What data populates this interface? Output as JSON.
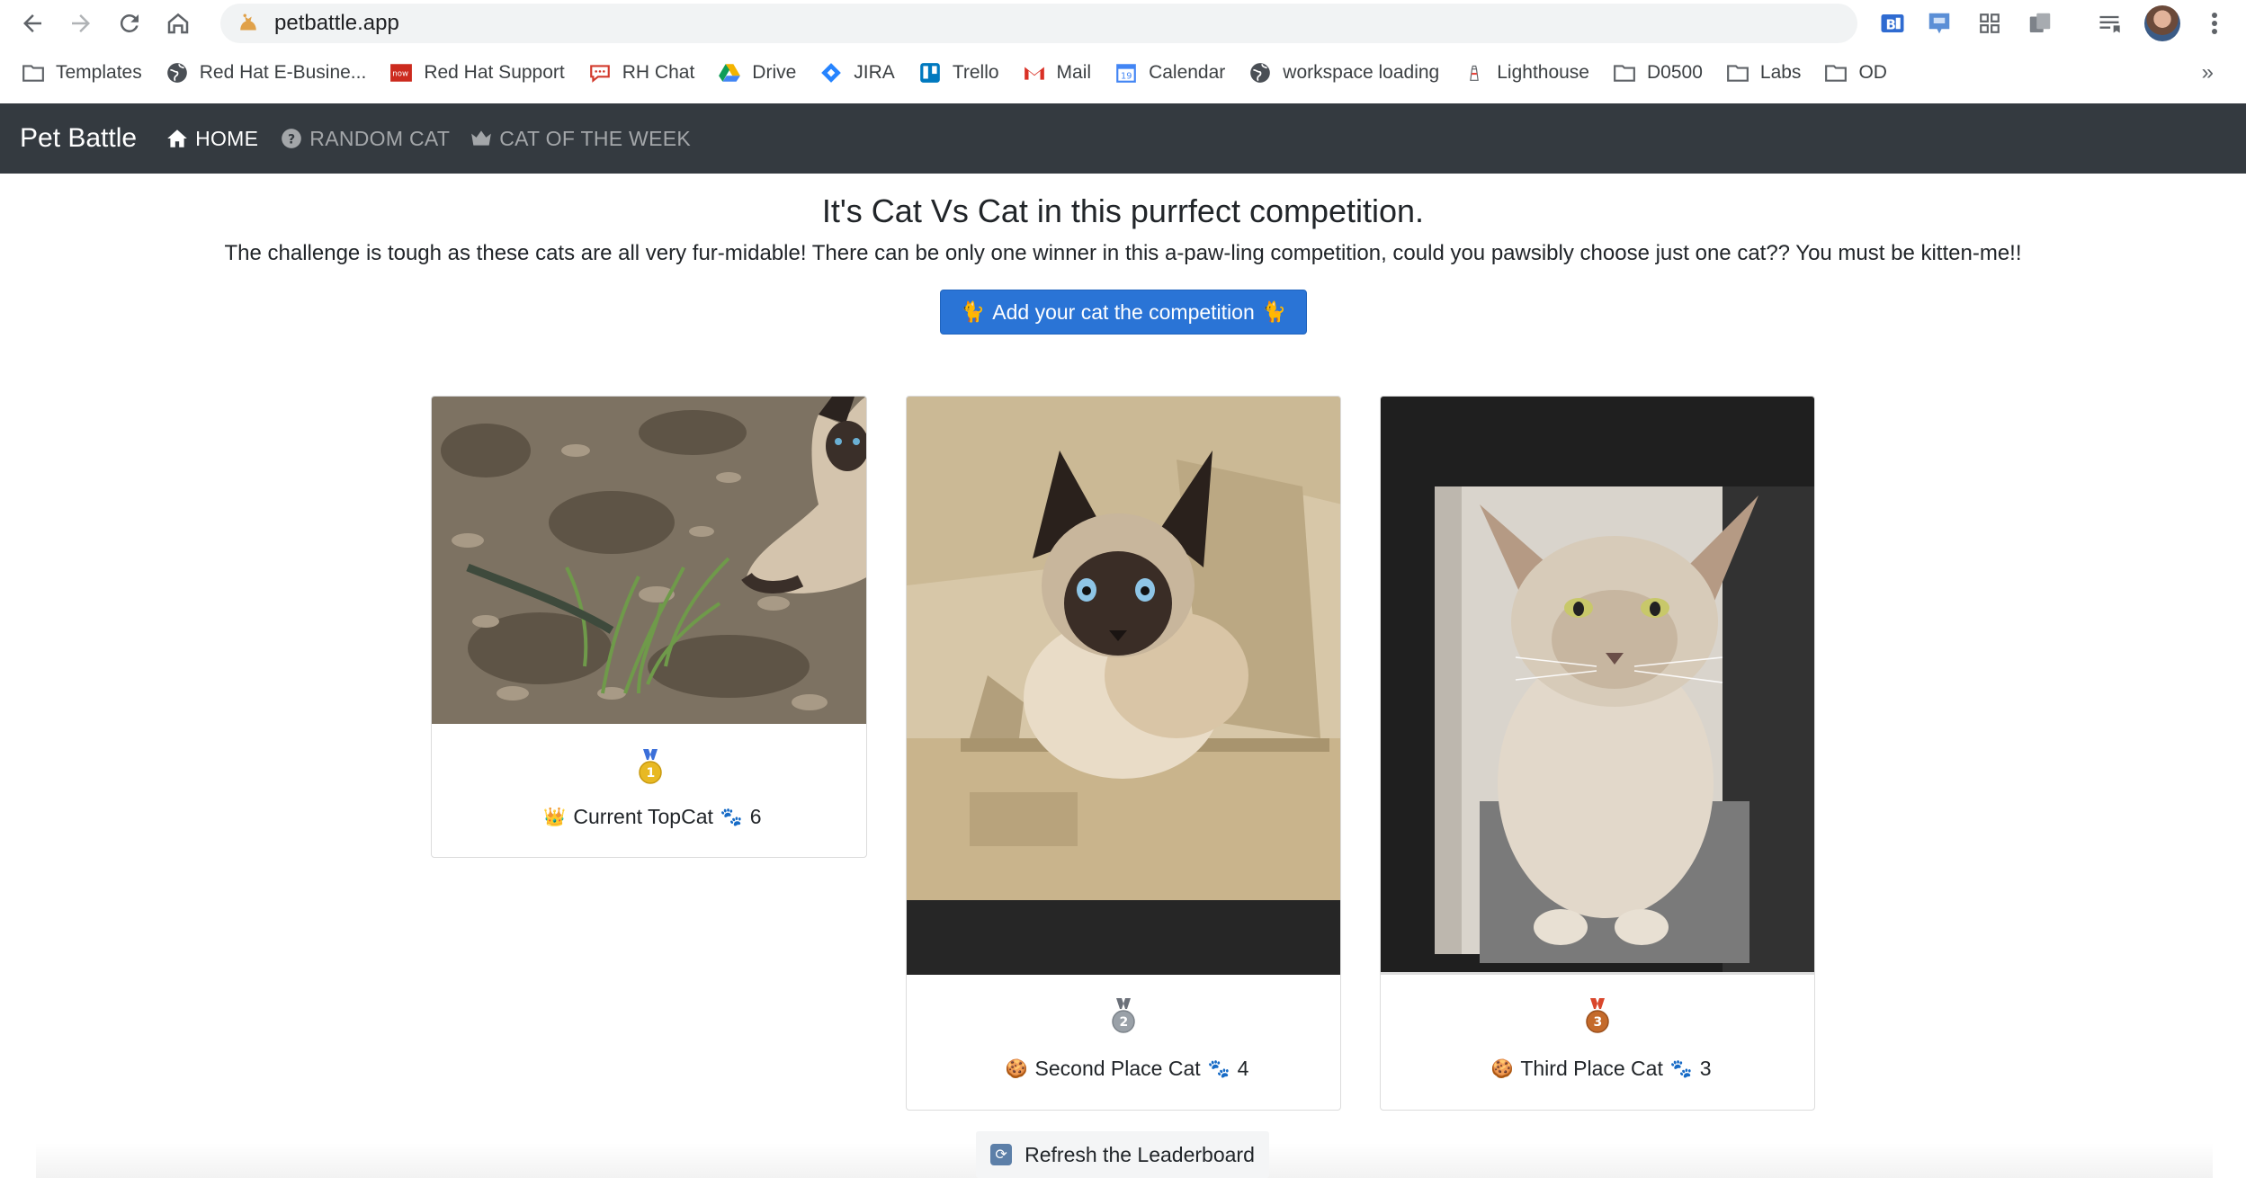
{
  "browser": {
    "url": "petbattle.app",
    "bookmarks": [
      {
        "label": "Templates",
        "icon": "folder-icon"
      },
      {
        "label": "Red Hat E-Busine...",
        "icon": "globe-icon"
      },
      {
        "label": "Red Hat Support",
        "icon": "redhat-now-icon"
      },
      {
        "label": "RH Chat",
        "icon": "chat-icon"
      },
      {
        "label": "Drive",
        "icon": "drive-icon"
      },
      {
        "label": "JIRA",
        "icon": "jira-icon"
      },
      {
        "label": "Trello",
        "icon": "trello-icon"
      },
      {
        "label": "Mail",
        "icon": "gmail-icon"
      },
      {
        "label": "Calendar",
        "icon": "calendar-icon"
      },
      {
        "label": "workspace loading",
        "icon": "globe-icon"
      },
      {
        "label": "Lighthouse",
        "icon": "lighthouse-icon"
      },
      {
        "label": "D0500",
        "icon": "folder-icon"
      },
      {
        "label": "Labs",
        "icon": "folder-icon"
      },
      {
        "label": "OD",
        "icon": "folder-icon"
      }
    ],
    "bookmarks_more": "»",
    "calendar_day": "19"
  },
  "app": {
    "brand": "Pet Battle",
    "nav": {
      "home": "HOME",
      "random_cat": "RANDOM CAT",
      "cat_of_week": "CAT OF THE WEEK"
    },
    "headline": "It's Cat Vs Cat in this purrfect competition.",
    "lead": "The challenge is tough as these cats are all very fur-midable! There can be only one winner in this a-paw-ling competition, could you pawsibly choose just one cat?? You must be kitten-me!!",
    "add_button": "Add your cat the competition",
    "cat_emoji": "🐈",
    "cards": [
      {
        "medal": "1",
        "caption": "Current TopCat",
        "caption_emoji": "👑",
        "paw": "🐾",
        "votes": "6",
        "medal_color": "#e8b923"
      },
      {
        "medal": "2",
        "caption": "Second Place Cat",
        "caption_emoji": "🍪",
        "paw": "🐾",
        "votes": "4",
        "medal_color": "#9aa1a8"
      },
      {
        "medal": "3",
        "caption": "Third Place Cat",
        "caption_emoji": "🍪",
        "paw": "🐾",
        "votes": "3",
        "medal_color": "#c46a2b"
      }
    ],
    "refresh_button": "Refresh the Leaderboard"
  },
  "colors": {
    "navbar_bg": "#343a40",
    "primary_button": "#2a74d6"
  }
}
